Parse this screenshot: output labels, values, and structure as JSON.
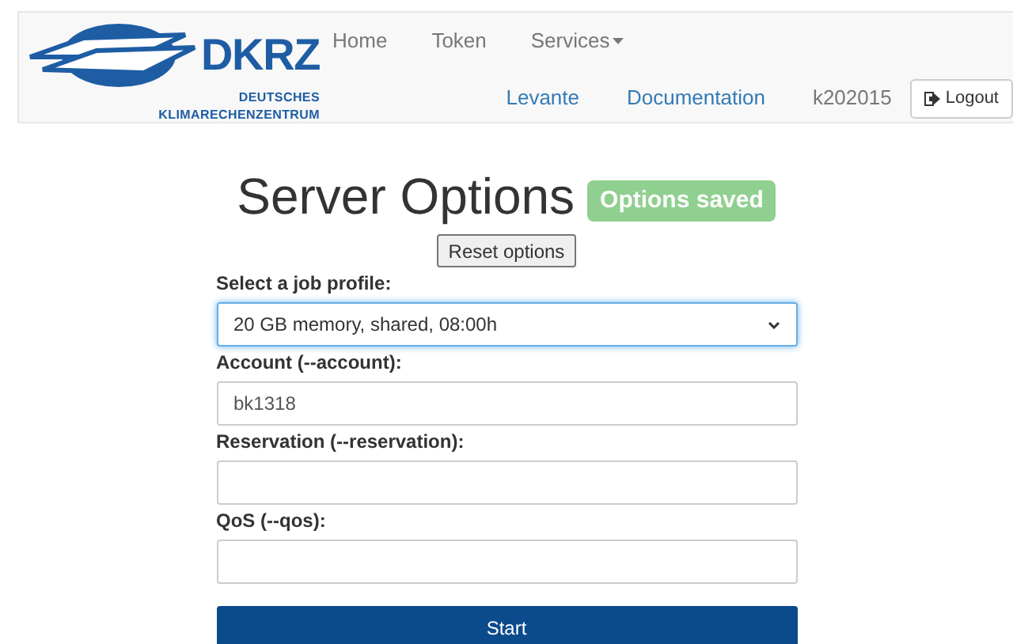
{
  "logo": {
    "name": "DKRZ",
    "subtitle_lines": [
      "DEUTSCHES",
      "KLIMARECHENZENTRUM"
    ]
  },
  "nav": {
    "top_links": [
      {
        "label": "Home",
        "kind": "link"
      },
      {
        "label": "Token",
        "kind": "link"
      },
      {
        "label": "Services",
        "kind": "dropdown"
      }
    ],
    "bottom_links": [
      "Levante",
      "Documentation"
    ],
    "user": "k202015",
    "logout": "Logout"
  },
  "title": "Server Options",
  "badge": "Options saved",
  "reset_button": "Reset options",
  "fields": [
    {
      "kind": "select",
      "label": "Select a job profile:",
      "value": "20 GB memory, shared, 08:00h",
      "focused": true
    },
    {
      "kind": "text",
      "label": "Account (--account):",
      "value": "bk1318",
      "focused": false
    },
    {
      "kind": "text",
      "label": "Reservation (--reservation):",
      "focused": false
    },
    {
      "kind": "text",
      "label": "QoS (--qos):",
      "focused": false
    }
  ],
  "start_button": "Start"
}
